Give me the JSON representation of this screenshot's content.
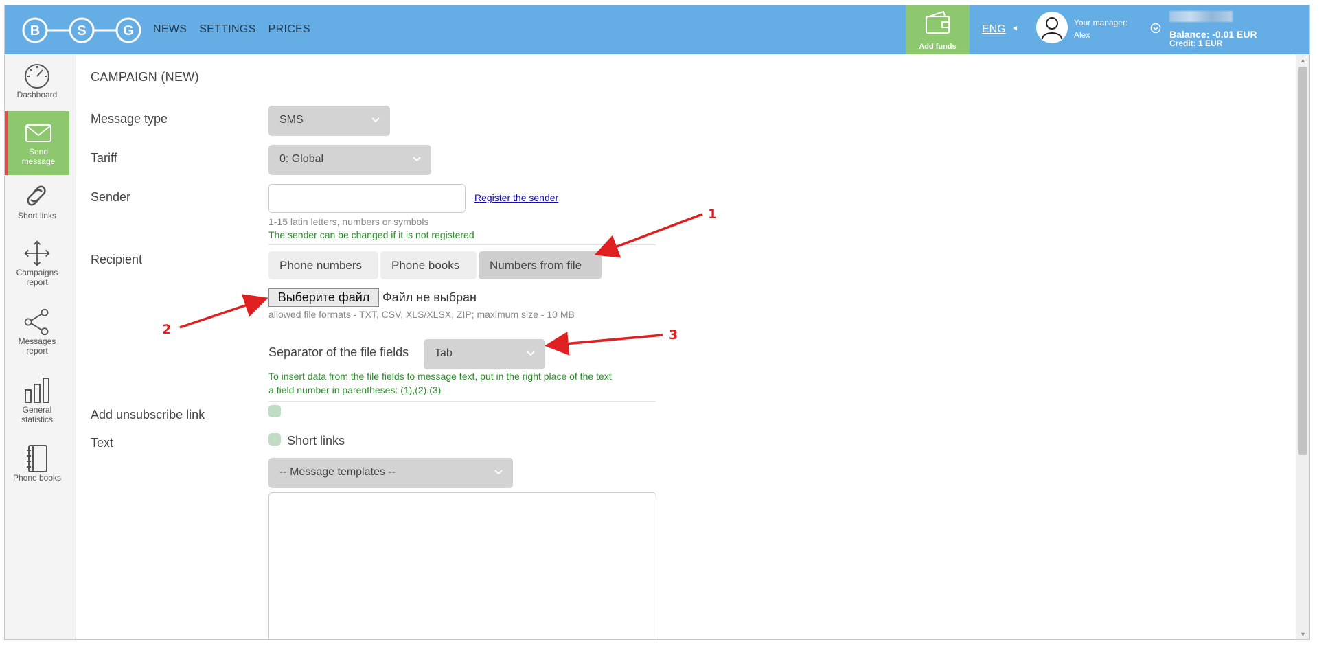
{
  "header": {
    "logo_letters": [
      "B",
      "S",
      "G"
    ],
    "nav": [
      "NEWS",
      "SETTINGS",
      "PRICES"
    ],
    "add_funds": "Add funds",
    "language": "ENG",
    "manager_label": "Your manager:",
    "manager_name": "Alex",
    "balance": "Balance: -0.01 EUR",
    "credit": "Credit: 1 EUR"
  },
  "sidebar": {
    "items": [
      {
        "label": "Dashboard",
        "icon": "gauge-icon"
      },
      {
        "label": "Send message",
        "icon": "envelope-icon",
        "active": true
      },
      {
        "label": "Short links",
        "icon": "link-icon"
      },
      {
        "label": "Campaigns report",
        "icon": "move-arrows-icon"
      },
      {
        "label": "Messages report",
        "icon": "share-icon"
      },
      {
        "label": "General statistics",
        "icon": "bar-chart-icon"
      },
      {
        "label": "Phone books",
        "icon": "notebook-icon"
      }
    ]
  },
  "form": {
    "title": "CAMPAIGN (NEW)",
    "message_type_label": "Message type",
    "message_type_value": "SMS",
    "tariff_label": "Tariff",
    "tariff_value": "0: Global",
    "sender_label": "Sender",
    "sender_value": "",
    "register_sender": "Register the sender",
    "sender_hint": "1-15 latin letters, numbers or symbols",
    "sender_note": "The sender can be changed if it is not registered",
    "recipient_label": "Recipient",
    "recipient_tabs": [
      "Phone numbers",
      "Phone books",
      "Numbers from file"
    ],
    "active_recipient_tab": "Numbers from file",
    "choose_file_button": "Выберите файл",
    "file_status": "Файл не выбран",
    "file_formats_hint": "allowed file formats - TXT, CSV, XLS/XLSX, ZIP; maximum size - 10 MB",
    "separator_label": "Separator of the file fields",
    "separator_value": "Tab",
    "insert_hint_line1": "To insert data from the file fields to message text, put in the right place of the text",
    "insert_hint_line2": "a field number in parentheses: (1),(2),(3)",
    "unsubscribe_label": "Add unsubscribe link",
    "text_label": "Text",
    "short_links_label": "Short links",
    "templates_value": "-- Message templates --",
    "text_value": ""
  },
  "annotations": [
    "1",
    "2",
    "3"
  ],
  "colors": {
    "header_bg": "#65ade5",
    "accent_green": "#8dc86f",
    "active_marker": "#e24b4b",
    "annotation_red": "#e02020"
  }
}
